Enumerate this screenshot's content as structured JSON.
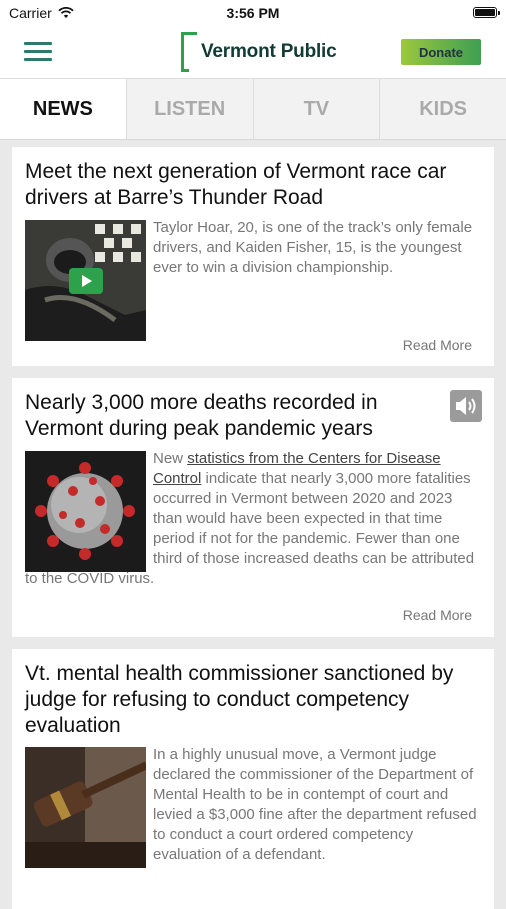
{
  "status": {
    "carrier": "Carrier",
    "time": "3:56 PM"
  },
  "header": {
    "logo_text": "Vermont Public",
    "donate_label": "Donate"
  },
  "tabs": [
    {
      "label": "NEWS"
    },
    {
      "label": "LISTEN"
    },
    {
      "label": "TV"
    },
    {
      "label": "KIDS"
    }
  ],
  "stories": [
    {
      "title": "Meet the next generation of Vermont race car drivers at Barre’s Thunder Road",
      "summary": "Taylor Hoar, 20, is one of the track’s only female drivers, and Kaiden Fisher, 15, is the youngest ever to win a division championship.",
      "read_more": "Read More"
    },
    {
      "title": "Nearly 3,000 more deaths recorded in Vermont during peak pandemic years",
      "summary_prefix": "New ",
      "summary_link": "statistics from the Centers for Disease Control",
      "summary_rest": " indicate that nearly 3,000 more fatalities occurred in Vermont between 2020 and 2023 than would have been expected in that time period if not for the pandemic. Fewer than one third of those increased deaths can be attributed to the COVID virus.",
      "read_more": "Read More"
    },
    {
      "title": "Vt. mental health commissioner sanctioned by judge for refusing to conduct competency evaluation",
      "summary": "In a highly unusual move, a Vermont judge declared the commissioner of the Department of Mental Health to be in contempt of court and levied a $3,000 fine after the department refused to conduct a court ordered competency evaluation of a defendant."
    }
  ],
  "colors": {
    "accent": "#2b7a6c",
    "donate": "#6fb548"
  }
}
